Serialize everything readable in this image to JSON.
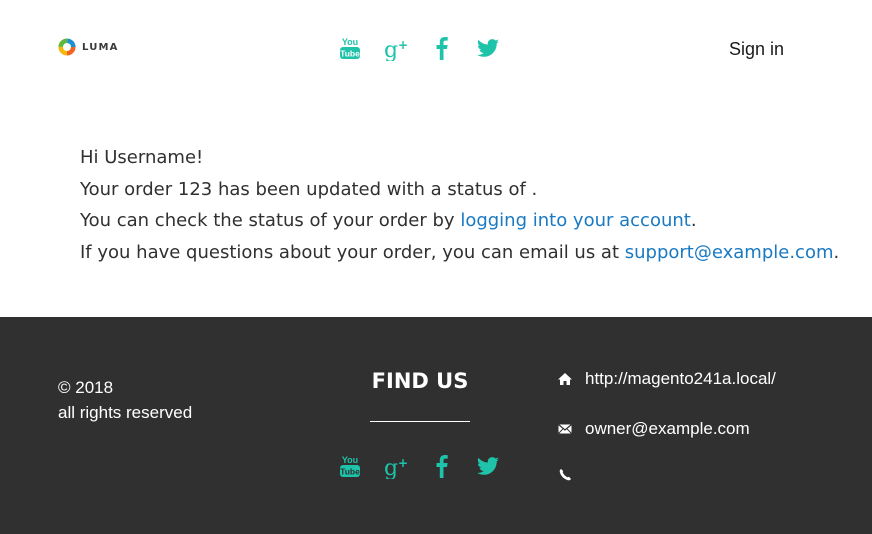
{
  "header": {
    "logo_text": "LUMA",
    "social_icons": [
      "youtube-icon",
      "google-plus-icon",
      "facebook-icon",
      "twitter-icon"
    ],
    "signin_label": "Sign in"
  },
  "message": {
    "greeting": "Hi Username!",
    "status_line": "Your order 123 has been updated with a status of .",
    "check_prefix": "You can check the status of your order by ",
    "check_link": "logging into your account",
    "check_suffix": ".",
    "questions_prefix": "If you have questions about your order, you can email us at ",
    "questions_email": "support@example.com",
    "questions_suffix": "."
  },
  "footer": {
    "copyright_year": "© 2018",
    "rights": "all rights reserved",
    "findus_title": "FIND US",
    "website": "http://magento241a.local/",
    "email": "owner@example.com",
    "phone": ""
  },
  "colors": {
    "accent_teal": "#1ec3a9",
    "link_blue": "#1979c3",
    "footer_bg": "#303030",
    "text": "#303030"
  }
}
